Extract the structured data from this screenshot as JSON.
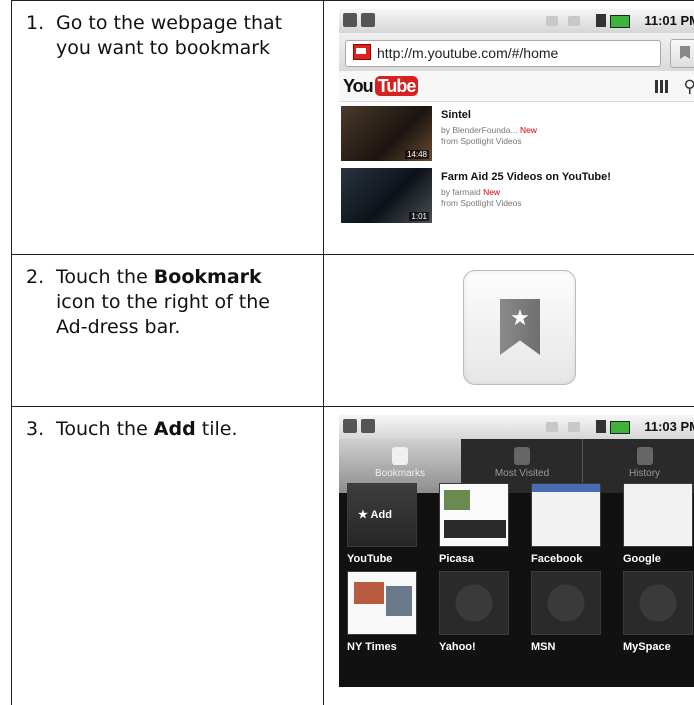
{
  "steps": [
    {
      "num": "1.",
      "text": "Go to the webpage that you want to bookmark"
    },
    {
      "num": "2.",
      "pre": "Touch the ",
      "bold": "Bookmark",
      "post": " icon to the right of the Ad-dress bar."
    },
    {
      "num": "3.",
      "pre": "Touch the ",
      "bold": "Add",
      "post": " tile."
    }
  ],
  "screen1": {
    "time": "11:01 PM",
    "url": "http://m.youtube.com/#/home",
    "logo_you": "You",
    "logo_tube": "Tube",
    "videos": [
      {
        "title": "Sintel",
        "by": "by BlenderFounda...",
        "new": "New",
        "from": "from Spotlight Videos",
        "duration": "14:48"
      },
      {
        "title": "Farm Aid 25 Videos on YouTube!",
        "by": "by farmaid",
        "new": "New",
        "from": "from Spotlight Videos",
        "duration": "1:01"
      }
    ]
  },
  "screen3": {
    "time": "11:03 PM",
    "tabs": [
      "Bookmarks",
      "Most Visited",
      "History"
    ],
    "add_label": "Add",
    "tiles": [
      "YouTube",
      "Picasa",
      "Facebook",
      "Google",
      "NY Times",
      "Yahoo!",
      "MSN",
      "MySpace"
    ]
  },
  "icons": [
    "bookmark-icon",
    "star-icon",
    "search-icon",
    "grid-icon",
    "eye-icon",
    "clock-icon"
  ],
  "colors": {
    "battery": "#3db33d",
    "youtube_red": "#d82020",
    "new_red": "#dd0000"
  }
}
